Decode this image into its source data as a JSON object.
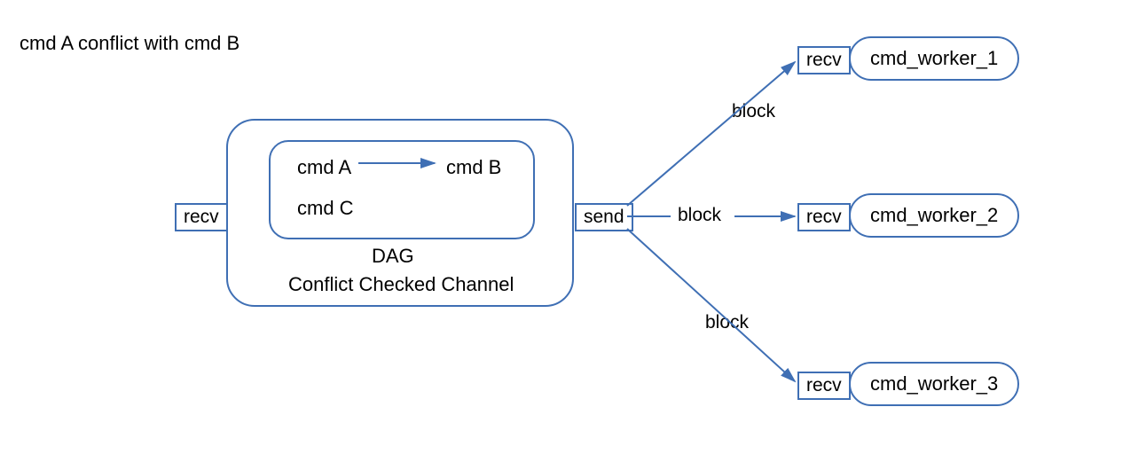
{
  "caption": "cmd A conflict with cmd B",
  "ports": {
    "recv": "recv",
    "send": "send"
  },
  "channel": {
    "dag_label": "DAG",
    "title": "Conflict Checked Channel",
    "cmd_a": "cmd A",
    "cmd_b": "cmd B",
    "cmd_c": "cmd C"
  },
  "edges": {
    "block": "block"
  },
  "workers": {
    "w1": "cmd_worker_1",
    "w2": "cmd_worker_2",
    "w3": "cmd_worker_3"
  }
}
